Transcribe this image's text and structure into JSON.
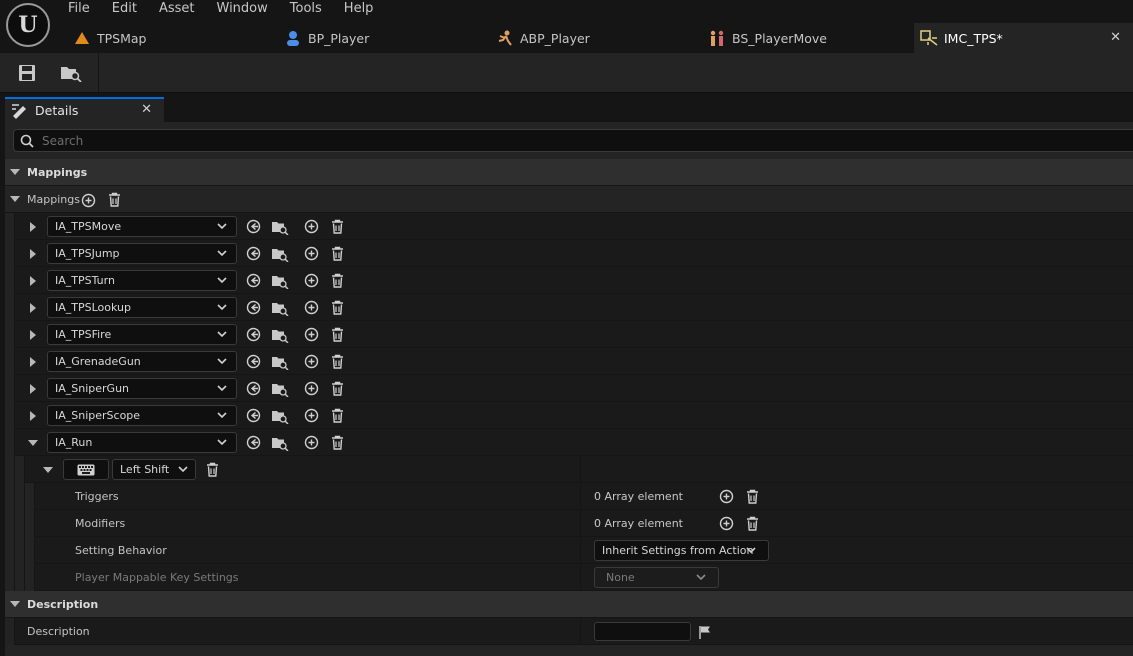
{
  "menu": [
    "File",
    "Edit",
    "Asset",
    "Window",
    "Tools",
    "Help"
  ],
  "tabs": [
    {
      "label": "TPSMap",
      "icon": "level-icon"
    },
    {
      "label": "BP_Player",
      "icon": "blueprint-pawn-icon"
    },
    {
      "label": "ABP_Player",
      "icon": "anim-blueprint-icon"
    },
    {
      "label": "BS_PlayerMove",
      "icon": "blend-space-icon"
    },
    {
      "label": "IMC_TPS*",
      "icon": "input-mapping-context-icon",
      "active": true
    }
  ],
  "toolbar": {
    "save_icon": "save-icon",
    "browse_icon": "browse-to-asset-icon"
  },
  "details": {
    "tab_label": "Details",
    "search_placeholder": "Search",
    "category_mappings": "Mappings",
    "mappings_label": "Mappings",
    "actions": [
      "IA_TPSMove",
      "IA_TPSJump",
      "IA_TPSTurn",
      "IA_TPSLookup",
      "IA_TPSFire",
      "IA_GrenadeGun",
      "IA_SniperGun",
      "IA_SniperScope",
      "IA_Run"
    ],
    "expanded_action": "IA_Run",
    "key_binding": {
      "key": "Left Shift"
    },
    "props": {
      "triggers_label": "Triggers",
      "triggers_value": "0 Array element",
      "modifiers_label": "Modifiers",
      "modifiers_value": "0 Array element",
      "setting_behavior_label": "Setting Behavior",
      "setting_behavior_value": "Inherit Settings from Action",
      "player_mappable_label": "Player Mappable Key Settings",
      "player_mappable_value": "None"
    },
    "category_description": "Description",
    "description_label": "Description",
    "description_value": ""
  },
  "colors": {
    "accent": "#0070e0",
    "background": "#151515",
    "panel": "#242424"
  }
}
